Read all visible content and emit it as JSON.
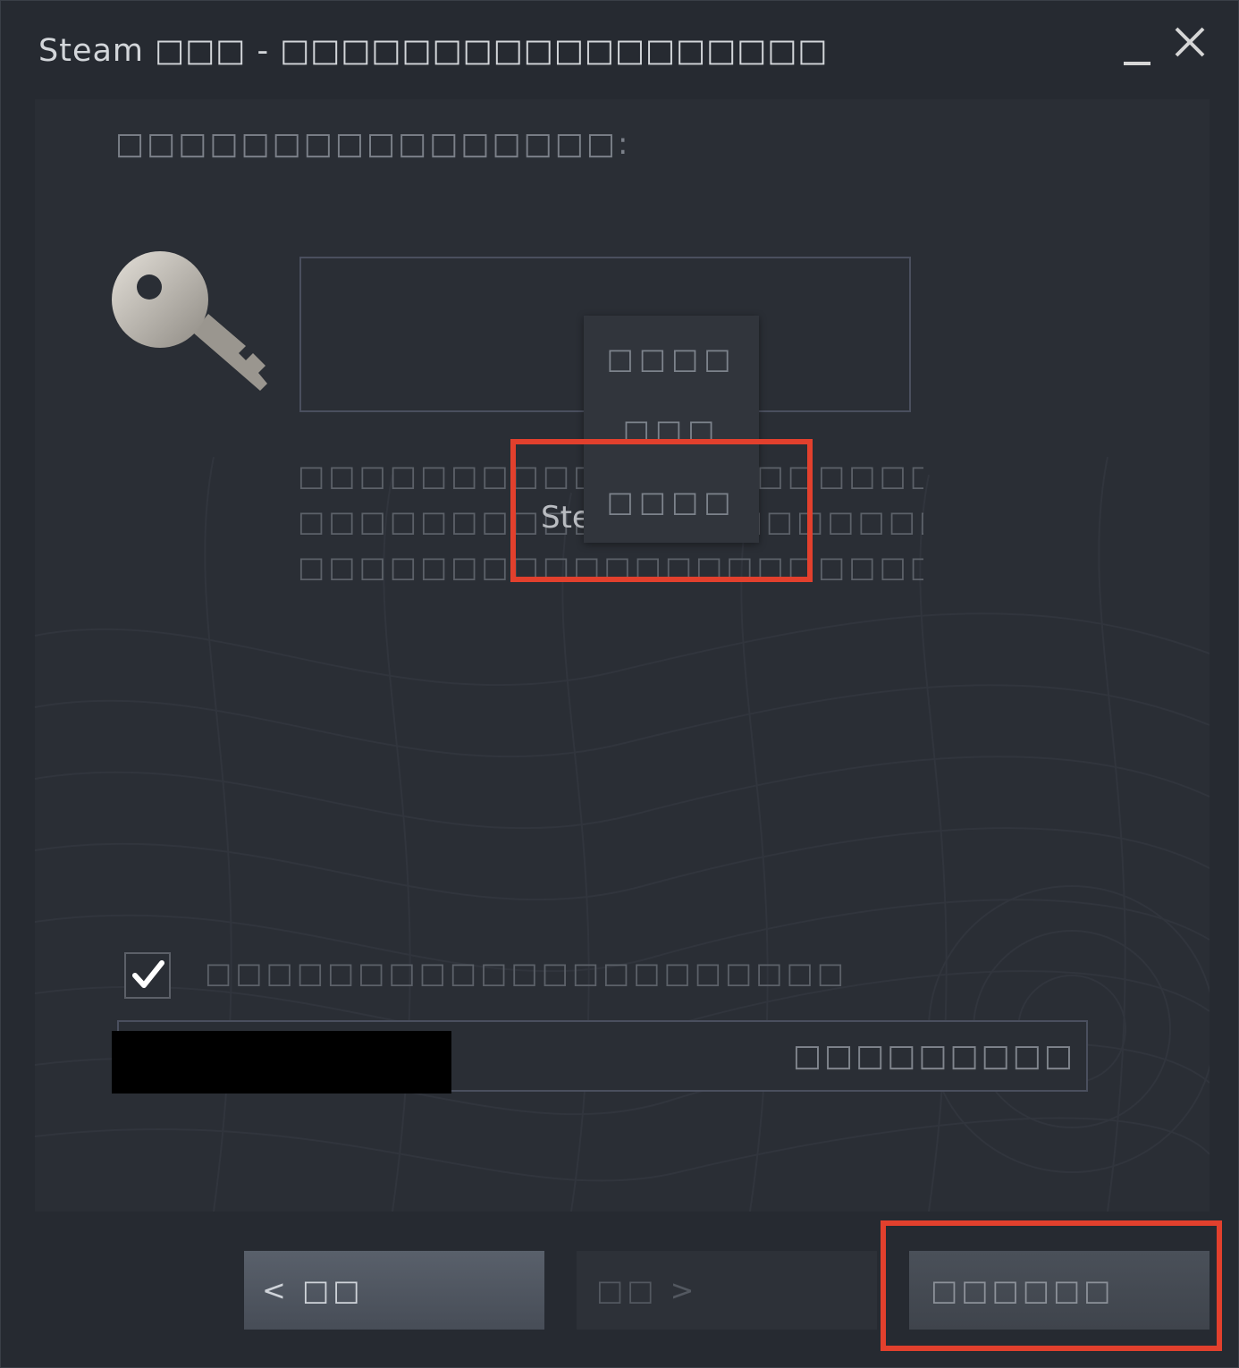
{
  "window": {
    "title": "Steam □□□ - □□□□□□□□□□□□□□□□□□",
    "minimize_label": "_",
    "close_icon": "close-icon"
  },
  "main": {
    "instruction": "□□□□□□□□□□□□□□□□:",
    "product_code_input": {
      "value": "",
      "placeholder": ""
    },
    "help_text": {
      "lines": [
        "□□□□□□□□□□□□□□□□□□□□□□□□",
        "□□□□□□□□□□ Ste□□□□□□□□□□",
        "□□□□□□□□□□□□□□□□□□□□□□□□□□□"
      ],
      "overlap_fragment": "Ste"
    },
    "context_menu": {
      "items": [
        "□□□□",
        "□□□",
        "□□□□"
      ]
    },
    "checkbox": {
      "checked": true,
      "label": "□□□□□□□□□□□□□□□□□□□□□"
    },
    "progress_row": {
      "text": "□□□□□□□□□"
    }
  },
  "footer": {
    "back_label": "< □□",
    "next_label": "□□ >",
    "cancel_label": "□□□□□□"
  },
  "colors": {
    "background": "#262a31",
    "highlight": "#e2402d",
    "text_muted": "#5c6169"
  }
}
